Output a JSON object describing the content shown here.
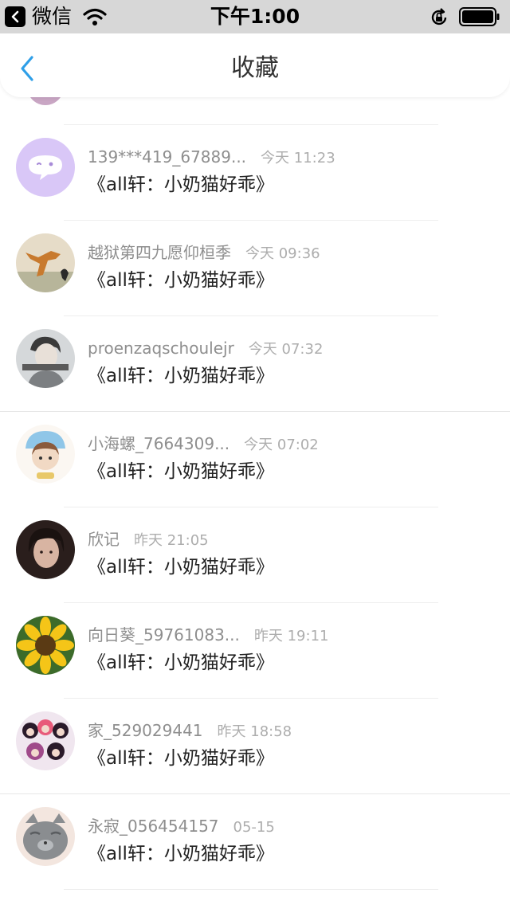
{
  "status_bar": {
    "back_app_label": "微信",
    "time": "下午1:00"
  },
  "nav": {
    "title": "收藏"
  },
  "items": [
    {
      "name": "139***419_67889...",
      "time": "今天 11:23",
      "content": "《all轩：小奶猫好乖》",
      "avatar": "wechat-bubble-avatar"
    },
    {
      "name": "越狱第四九愿仰桓季",
      "time": "今天 09:36",
      "content": "《all轩：小奶猫好乖》",
      "avatar": "dog-avatar"
    },
    {
      "name": "proenzaqschoulejr",
      "time": "今天 07:32",
      "content": "《all轩：小奶猫好乖》",
      "avatar": "portrait-avatar"
    },
    {
      "name": "小海螺_7664309...",
      "time": "今天 07:02",
      "content": "《all轩：小奶猫好乖》",
      "avatar": "cartoon-avatar"
    },
    {
      "name": "欣记",
      "time": "昨天 21:05",
      "content": "《all轩：小奶猫好乖》",
      "avatar": "girl-avatar"
    },
    {
      "name": "向日葵_59761083...",
      "time": "昨天 19:11",
      "content": "《all轩：小奶猫好乖》",
      "avatar": "sunflower-avatar"
    },
    {
      "name": "家_529029441",
      "time": "昨天 18:58",
      "content": "《all轩：小奶猫好乖》",
      "avatar": "group-avatar"
    },
    {
      "name": "永寂_056454157",
      "time": "05-15",
      "content": "《all轩：小奶猫好乖》",
      "avatar": "cat-avatar"
    }
  ],
  "colors": {
    "accent": "#2f9fe8",
    "status_bar_bg": "#d7d7d7",
    "name_text": "#8e8e8e",
    "time_text": "#adadad",
    "content_text": "#222222"
  }
}
